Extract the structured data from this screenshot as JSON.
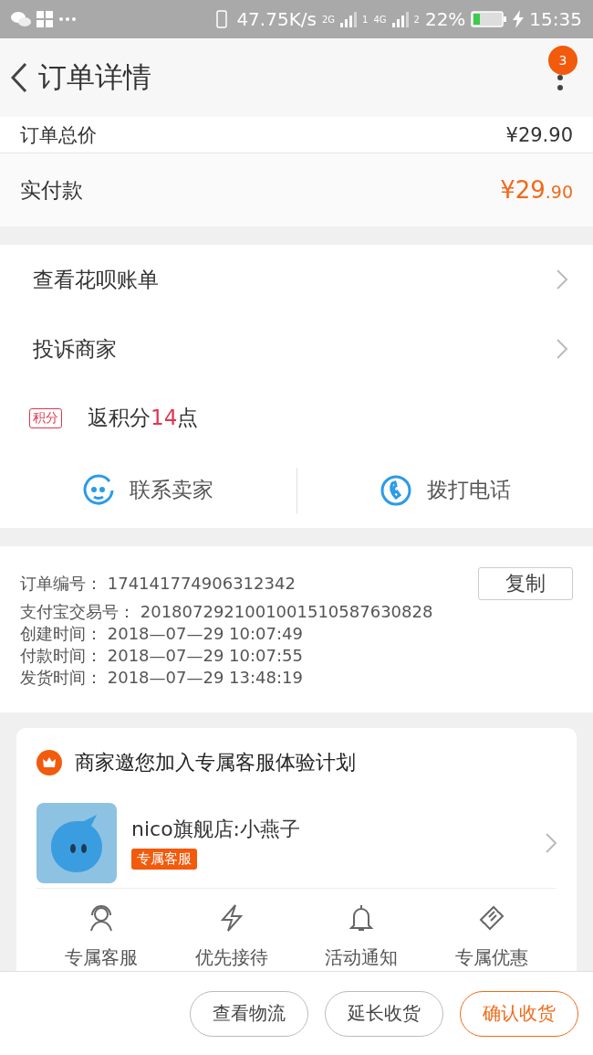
{
  "status_bar": {
    "speed": "47.75K/s",
    "sim1_type": "2G",
    "sim1": "1",
    "sim2_type": "4G",
    "sim2": "2",
    "battery": "22%",
    "time": "15:35"
  },
  "header": {
    "title": "订单详情",
    "badge": "3"
  },
  "price_rows": [
    {
      "kind": "cut",
      "label": "订单总价",
      "value": "¥29.90"
    },
    {
      "kind": "paid",
      "label": "实付款",
      "currency": "¥",
      "value": "29",
      "decimals": ".90"
    }
  ],
  "links": [
    {
      "label": "查看花呗账单"
    },
    {
      "label": "投诉商家"
    }
  ],
  "points": {
    "tag": "积分",
    "prefix": "返积分",
    "amount": "14",
    "suffix": "点"
  },
  "contact": [
    {
      "kind": "chat",
      "label": "联系卖家"
    },
    {
      "kind": "phone",
      "label": "拨打电话"
    }
  ],
  "order_info": {
    "copy_button": "复制",
    "lines": [
      {
        "label": "订单编号：",
        "value": "174141774906312342"
      },
      {
        "label": "支付宝交易号：",
        "value": "2018072921001001510587630828"
      },
      {
        "label": "创建时间：",
        "value": "2018—07—29 10:07:49"
      },
      {
        "label": "付款时间：",
        "value": "2018—07—29 10:07:55"
      },
      {
        "label": "发货时间：",
        "value": "2018—07—29 13:48:19"
      }
    ]
  },
  "service_card": {
    "title": "商家邀您加入专属客服体验计划",
    "shop": "nico旗舰店:小燕子",
    "tag": "专属客服",
    "features": [
      {
        "kind": "agent",
        "label": "专属客服"
      },
      {
        "kind": "bolt",
        "label": "优先接待"
      },
      {
        "kind": "bell",
        "label": "活动通知"
      },
      {
        "kind": "ticket",
        "label": "专属优惠"
      }
    ]
  },
  "bottom_buttons": [
    {
      "label": "查看物流",
      "primary": false
    },
    {
      "label": "延长收货",
      "primary": false
    },
    {
      "label": "确认收货",
      "primary": true
    }
  ]
}
